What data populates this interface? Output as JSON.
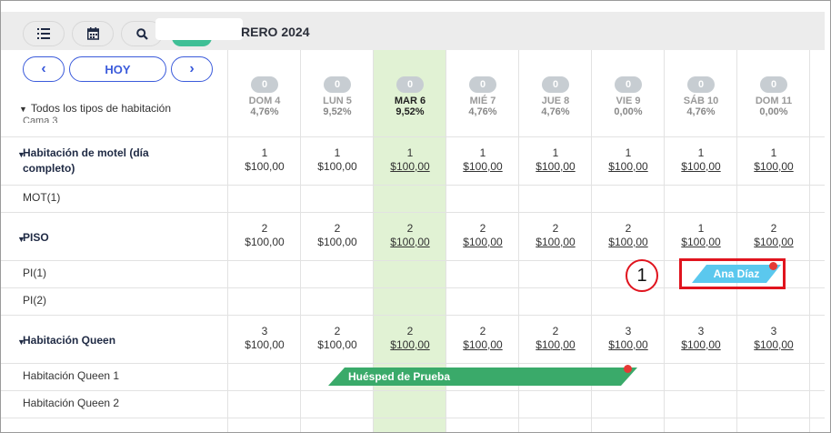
{
  "toolbar": {
    "today_label": "HOY",
    "prev_glyph": "‹",
    "next_glyph": "›",
    "list_icon": "list-icon",
    "calendar_icon": "calendar-icon",
    "search_icon": "search-icon"
  },
  "header": {
    "month_label": "RERO 2024"
  },
  "filter": {
    "all_types_label": "Todos los tipos de habitación"
  },
  "cut_row_label": "Cama 3",
  "days": [
    {
      "badge": "0",
      "name": "DOM 4",
      "pct": "4,76%"
    },
    {
      "badge": "0",
      "name": "LUN 5",
      "pct": "9,52%"
    },
    {
      "badge": "0",
      "name": "MAR 6",
      "pct": "9,52%"
    },
    {
      "badge": "0",
      "name": "MIÉ 7",
      "pct": "4,76%"
    },
    {
      "badge": "0",
      "name": "JUE 8",
      "pct": "4,76%"
    },
    {
      "badge": "0",
      "name": "VIE 9",
      "pct": "0,00%"
    },
    {
      "badge": "0",
      "name": "SÁB 10",
      "pct": "4,76%"
    },
    {
      "badge": "0",
      "name": "DOM 11",
      "pct": "0,00%"
    }
  ],
  "groups": [
    {
      "name": "Habitación de motel (día completo)",
      "availability": [
        {
          "count": "1",
          "price": "$100,00"
        },
        {
          "count": "1",
          "price": "$100,00"
        },
        {
          "count": "1",
          "price": "$100,00"
        },
        {
          "count": "1",
          "price": "$100,00"
        },
        {
          "count": "1",
          "price": "$100,00"
        },
        {
          "count": "1",
          "price": "$100,00"
        },
        {
          "count": "1",
          "price": "$100,00"
        },
        {
          "count": "1",
          "price": "$100,00"
        }
      ],
      "rooms": [
        "MOT(1)"
      ]
    },
    {
      "name": "PISO",
      "availability": [
        {
          "count": "2",
          "price": "$100,00"
        },
        {
          "count": "2",
          "price": "$100,00"
        },
        {
          "count": "2",
          "price": "$100,00"
        },
        {
          "count": "2",
          "price": "$100,00"
        },
        {
          "count": "2",
          "price": "$100,00"
        },
        {
          "count": "2",
          "price": "$100,00"
        },
        {
          "count": "1",
          "price": "$100,00"
        },
        {
          "count": "2",
          "price": "$100,00"
        }
      ],
      "rooms": [
        "PI(1)",
        "PI(2)"
      ]
    },
    {
      "name": "Habitación Queen",
      "availability": [
        {
          "count": "3",
          "price": "$100,00"
        },
        {
          "count": "2",
          "price": "$100,00"
        },
        {
          "count": "2",
          "price": "$100,00"
        },
        {
          "count": "2",
          "price": "$100,00"
        },
        {
          "count": "2",
          "price": "$100,00"
        },
        {
          "count": "3",
          "price": "$100,00"
        },
        {
          "count": "3",
          "price": "$100,00"
        },
        {
          "count": "3",
          "price": "$100,00"
        }
      ],
      "rooms": [
        "Habitación Queen 1",
        "Habitación Queen 2"
      ]
    }
  ],
  "bookings": [
    {
      "guest": "Ana Díaz",
      "color": "#5bc8ee"
    },
    {
      "guest": "Huésped de Prueba",
      "color": "#3aaa6a"
    }
  ],
  "annotation": {
    "number": "1"
  }
}
